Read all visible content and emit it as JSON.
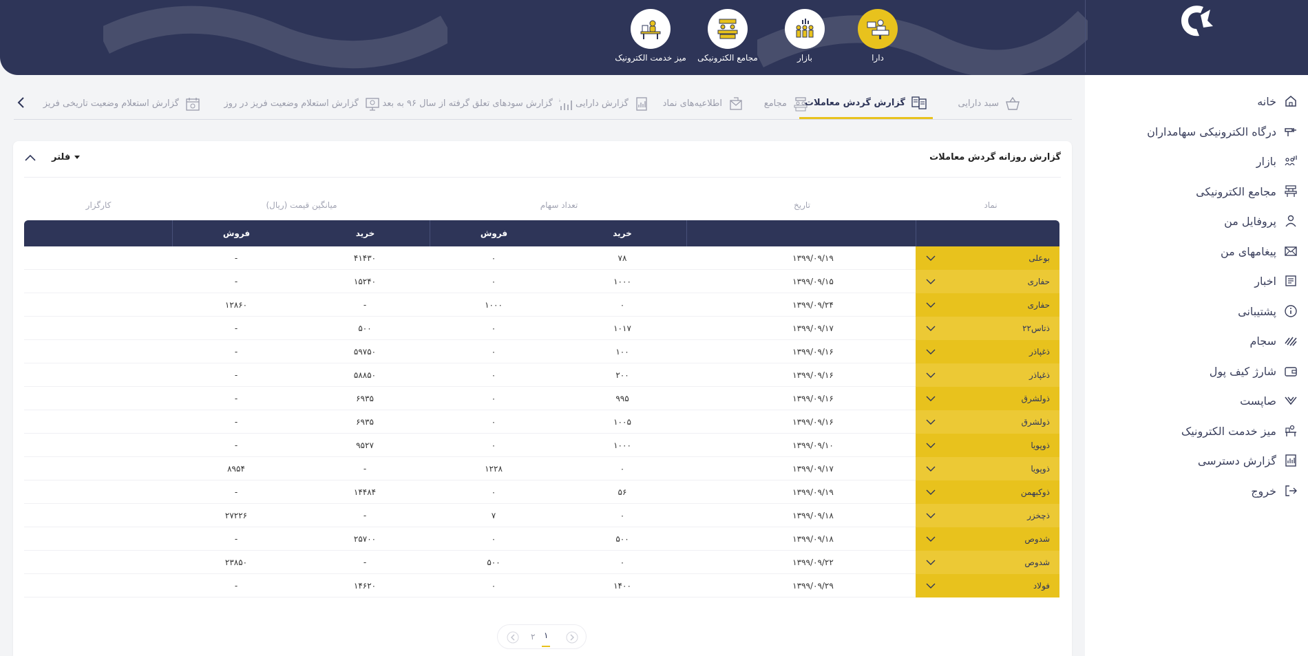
{
  "header": {
    "apps": [
      {
        "label": "دارا",
        "icon": "cashier-desk-icon",
        "active": true
      },
      {
        "label": "بازار",
        "icon": "market-people-icon",
        "active": false
      },
      {
        "label": "مجامع الکترونیکی",
        "icon": "assembly-people-icon",
        "active": false
      },
      {
        "label": "میز خدمت الکترونیک",
        "icon": "service-desk-icon",
        "active": false
      }
    ]
  },
  "sidebar": {
    "items": [
      {
        "label": "خانه",
        "icon": "home-icon"
      },
      {
        "label": "درگاه الکترونیکی سهامداران",
        "icon": "gateway-icon"
      },
      {
        "label": "بازار",
        "icon": "market-icon"
      },
      {
        "label": "مجامع الکترونیکی",
        "icon": "assembly-icon"
      },
      {
        "label": "پروفایل من",
        "icon": "user-icon"
      },
      {
        "label": "پیغامهای من",
        "icon": "mail-icon"
      },
      {
        "label": "اخبار",
        "icon": "news-icon"
      },
      {
        "label": "پشتیبانی",
        "icon": "info-icon"
      },
      {
        "label": "سجام",
        "icon": "sejam-icon"
      },
      {
        "label": "شارژ کیف پول",
        "icon": "wallet-icon"
      },
      {
        "label": "صاپست",
        "icon": "sapost-icon"
      },
      {
        "label": "میز خدمت الکترونیک",
        "icon": "service-desk-icon"
      },
      {
        "label": "گزارش دسترسی",
        "icon": "report-icon"
      },
      {
        "label": "خروج",
        "icon": "logout-icon"
      }
    ]
  },
  "tabs": [
    {
      "label": "سبد دارایی",
      "icon": "basket-icon",
      "active": false
    },
    {
      "label": "گزارش گردش معاملات",
      "icon": "transactions-icon",
      "active": true
    },
    {
      "label": "مجامع",
      "icon": "assembly-icon",
      "active": false
    },
    {
      "label": "اطلاعیه‌های نماد",
      "icon": "announcement-icon",
      "active": false
    },
    {
      "label": "گزارش دارایی",
      "icon": "asset-report-icon",
      "active": false
    },
    {
      "label": "گزارش سودهای تعلق گرفته از سال ۹۶ به بعد",
      "icon": "percent-chart-icon",
      "active": false
    },
    {
      "label": "گزارش استعلام وضعیت فریز در روز",
      "icon": "monitor-icon",
      "active": false
    },
    {
      "label": "گزارش استعلام وضعیت تاریخی فریز",
      "icon": "calendar-icon",
      "active": false
    }
  ],
  "report": {
    "title": "گزارش روزانه گردش معاملات",
    "filter_label": "فلتر",
    "columns": {
      "symbol": "نماد",
      "date": "تاریخ",
      "shares": "تعداد سهام",
      "avg_price": "میانگین قیمت (ریال)",
      "broker": "کارگزار"
    },
    "subheaders": {
      "buy": "خرید",
      "sell": "فروش"
    },
    "rows": [
      {
        "symbol": "بوعلی",
        "date": "۱۳۹۹/۰۹/۱۹",
        "shares_buy": "۷۸",
        "shares_sell": "۰",
        "price_buy": "۴۱۴۳۰",
        "price_sell": "-"
      },
      {
        "symbol": "حفاری",
        "date": "۱۳۹۹/۰۹/۱۵",
        "shares_buy": "۱۰۰۰",
        "shares_sell": "۰",
        "price_buy": "۱۵۲۴۰",
        "price_sell": "-"
      },
      {
        "symbol": "حفاری",
        "date": "۱۳۹۹/۰۹/۲۴",
        "shares_buy": "۰",
        "shares_sell": "۱۰۰۰",
        "price_buy": "-",
        "price_sell": "۱۲۸۶۰"
      },
      {
        "symbol": "ذتاس۲۲",
        "date": "۱۳۹۹/۰۹/۱۷",
        "shares_buy": "۱۰۱۷",
        "shares_sell": "۰",
        "price_buy": "۵۰۰",
        "price_sell": "-"
      },
      {
        "symbol": "ذغپاذر",
        "date": "۱۳۹۹/۰۹/۱۶",
        "shares_buy": "۱۰۰",
        "shares_sell": "۰",
        "price_buy": "۵۹۷۵۰",
        "price_sell": "-"
      },
      {
        "symbol": "ذغپاذر",
        "date": "۱۳۹۹/۰۹/۱۶",
        "shares_buy": "۲۰۰",
        "shares_sell": "۰",
        "price_buy": "۵۸۸۵۰",
        "price_sell": "-"
      },
      {
        "symbol": "ذولشرق",
        "date": "۱۳۹۹/۰۹/۱۶",
        "shares_buy": "۹۹۵",
        "shares_sell": "۰",
        "price_buy": "۶۹۳۵",
        "price_sell": "-"
      },
      {
        "symbol": "ذولشرق",
        "date": "۱۳۹۹/۰۹/۱۶",
        "shares_buy": "۱۰۰۵",
        "shares_sell": "۰",
        "price_buy": "۶۹۳۵",
        "price_sell": "-"
      },
      {
        "symbol": "ذوپویا",
        "date": "۱۳۹۹/۰۹/۱۰",
        "shares_buy": "۱۰۰۰",
        "shares_sell": "۰",
        "price_buy": "۹۵۲۷",
        "price_sell": "-"
      },
      {
        "symbol": "ذوپویا",
        "date": "۱۳۹۹/۰۹/۱۷",
        "shares_buy": "۰",
        "shares_sell": "۱۲۲۸",
        "price_buy": "-",
        "price_sell": "۸۹۵۴"
      },
      {
        "symbol": "ذوکبهمن",
        "date": "۱۳۹۹/۰۹/۱۹",
        "shares_buy": "۵۶",
        "shares_sell": "۰",
        "price_buy": "۱۴۴۸۴",
        "price_sell": "-"
      },
      {
        "symbol": "ذچخزر",
        "date": "۱۳۹۹/۰۹/۱۸",
        "shares_buy": "۰",
        "shares_sell": "۷",
        "price_buy": "-",
        "price_sell": "۲۷۲۲۶"
      },
      {
        "symbol": "شدوص",
        "date": "۱۳۹۹/۰۹/۱۸",
        "shares_buy": "۵۰۰",
        "shares_sell": "۰",
        "price_buy": "۲۵۷۰۰",
        "price_sell": "-"
      },
      {
        "symbol": "شدوص",
        "date": "۱۳۹۹/۰۹/۲۲",
        "shares_buy": "۰",
        "shares_sell": "۵۰۰",
        "price_buy": "-",
        "price_sell": "۲۳۸۵۰"
      },
      {
        "symbol": "فولاد",
        "date": "۱۳۹۹/۰۹/۲۹",
        "shares_buy": "۱۴۰۰",
        "shares_sell": "۰",
        "price_buy": "۱۴۶۲۰",
        "price_sell": "-"
      }
    ]
  },
  "pagination": {
    "pages": [
      "۱",
      "۲"
    ],
    "current": "۱"
  },
  "colors": {
    "header_bg": "#2e3558",
    "accent": "#e8c21d",
    "sidebar_text": "#3a3f5c"
  }
}
